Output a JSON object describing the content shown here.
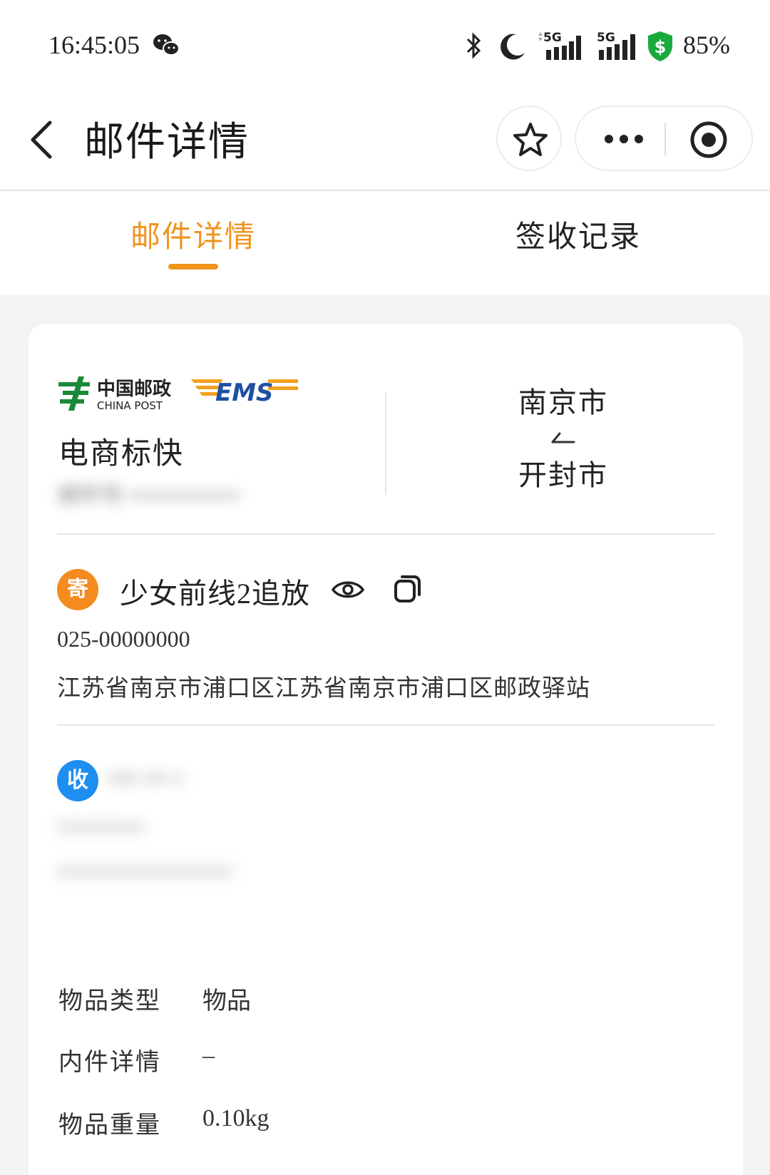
{
  "status_bar": {
    "time": "16:45:05",
    "signal1_label": "5G",
    "signal2_label": "5G",
    "battery": "85%"
  },
  "header": {
    "title": "邮件详情"
  },
  "tabs": [
    {
      "label": "邮件详情",
      "active": true
    },
    {
      "label": "签收记录",
      "active": false
    }
  ],
  "shipment": {
    "logo_text_cn": "中国邮政",
    "logo_text_en": "CHINA POST",
    "logo_ems": "EMS",
    "service_name": "电商标快",
    "mail_number_blurred": "邮件号 •••••••••••••••",
    "route_from": "南京市",
    "route_to": "开封市"
  },
  "sender": {
    "badge": "寄",
    "name": "少女前线2追放",
    "phone": "025-00000000",
    "address": "江苏省南京市浦口区江苏省南京市浦口区邮政驿站"
  },
  "recipient": {
    "badge": "收",
    "name_blurred": "••• •• •",
    "phone_blurred": "•••••••••••",
    "address_blurred": "••••••••••••••••••••••"
  },
  "item_info": [
    {
      "label": "物品类型",
      "value": "物品"
    },
    {
      "label": "内件详情",
      "value": "–"
    },
    {
      "label": "物品重量",
      "value": "0.10kg"
    }
  ],
  "colors": {
    "accent": "#f0941e",
    "send_badge": "#f58a1f",
    "recv_badge": "#1e8ef0",
    "ems_blue": "#1f4fa3",
    "ems_orange": "#f0a21e",
    "china_post_green": "#1a8a3a"
  }
}
